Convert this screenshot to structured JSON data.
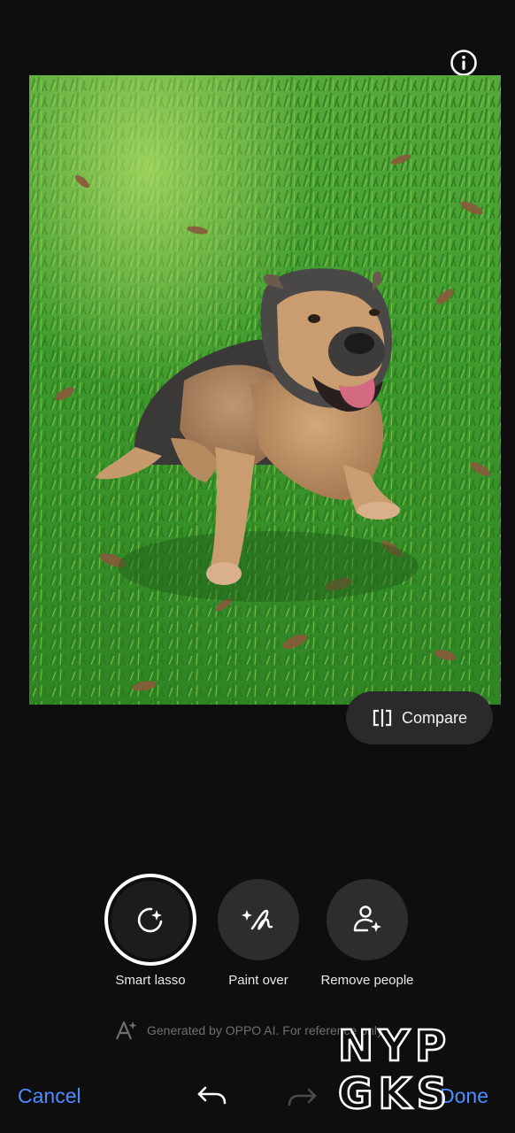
{
  "header": {
    "info_icon": "info-icon"
  },
  "photo": {
    "subject": "dog-on-grass",
    "colors": {
      "grass": "#3f9a2e",
      "dog_body": "#c79a6e",
      "dog_dark": "#3c3a3a"
    }
  },
  "compare": {
    "label": "Compare",
    "icon": "compare-icon"
  },
  "tools": {
    "items": [
      {
        "label": "Smart lasso",
        "icon": "smart-lasso-icon",
        "selected": true
      },
      {
        "label": "Paint over",
        "icon": "paint-over-icon",
        "selected": false
      },
      {
        "label": "Remove people",
        "icon": "remove-people-icon",
        "selected": false
      }
    ]
  },
  "ai_note": {
    "text": "Generated by OPPO AI. For reference only",
    "icon": "ai-sparkle-icon"
  },
  "footer": {
    "cancel_label": "Cancel",
    "done_label": "Done",
    "undo_icon": "undo-icon",
    "redo_icon": "redo-icon",
    "accent_color": "#4c8dff"
  },
  "watermark": {
    "line1": "NYP",
    "line2": "GKS"
  }
}
